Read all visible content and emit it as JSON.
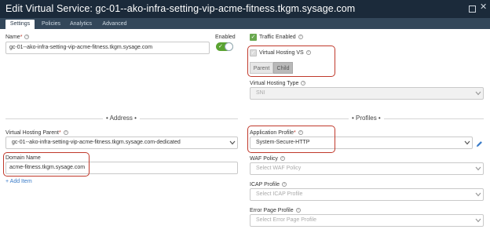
{
  "window": {
    "title": "Edit Virtual Service: gc-01--ako-infra-setting-vip-acme-fitness.tkgm.sysage.com"
  },
  "tabs": [
    {
      "label": "Settings",
      "active": true
    },
    {
      "label": "Policies",
      "active": false
    },
    {
      "label": "Analytics",
      "active": false
    },
    {
      "label": "Advanced",
      "active": false
    }
  ],
  "name_field": {
    "label": "Name",
    "value": "gc-01--ako-infra-setting-vip-acme-fitness.tkgm.sysage.com"
  },
  "enabled": {
    "label": "Enabled",
    "on": true
  },
  "traffic_enabled": {
    "label": "Traffic Enabled",
    "checked": true
  },
  "virtual_hosting_vs": {
    "label": "Virtual Hosting VS",
    "checked": true,
    "options": [
      "Parent",
      "Child"
    ],
    "selected": "Child"
  },
  "virtual_hosting_type": {
    "label": "Virtual Hosting Type",
    "value": "SNI"
  },
  "sections": {
    "address": "• Address •",
    "profiles": "• Profiles •"
  },
  "virtual_hosting_parent": {
    "label": "Virtual Hosting Parent",
    "value": "gc-01--ako-infra-setting-vip-acme-fitness.tkgm.sysage.com-dedicated"
  },
  "domain_name": {
    "label": "Domain Name",
    "value": "acme-fitness.tkgm.sysage.com"
  },
  "add_item": "+ Add Item",
  "application_profile": {
    "label": "Application Profile",
    "value": "System-Secure-HTTP"
  },
  "waf_policy": {
    "label": "WAF Policy",
    "placeholder": "Select WAF Policy"
  },
  "icap_profile": {
    "label": "ICAP Profile",
    "placeholder": "Select ICAP Profile"
  },
  "error_page_profile": {
    "label": "Error Page Profile",
    "placeholder": "Select Error Page Profile"
  },
  "colors": {
    "titlebar": "#1b2a3a",
    "tabbar": "#33475a",
    "toggle_on": "#5aa331",
    "checkbox": "#6aa84f",
    "highlight": "#c0392b",
    "link": "#3a7bc8"
  }
}
